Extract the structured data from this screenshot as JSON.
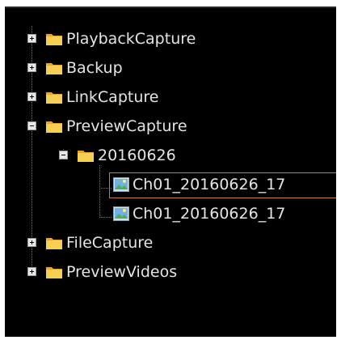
{
  "tree": {
    "items": [
      {
        "label": "PlaybackCapture",
        "icon": "folder-icon",
        "expander": "plus",
        "expanded": false
      },
      {
        "label": "Backup",
        "icon": "folder-icon",
        "expander": "plus",
        "expanded": false
      },
      {
        "label": "LinkCapture",
        "icon": "folder-icon",
        "expander": "plus",
        "expanded": false
      },
      {
        "label": "PreviewCapture",
        "icon": "folder-icon",
        "expander": "minus",
        "expanded": true,
        "children": [
          {
            "label": "20160626",
            "icon": "folder-icon",
            "expander": "minus",
            "expanded": true,
            "children": [
              {
                "label": "Ch01_20160626_17",
                "icon": "image-icon",
                "selected": true
              },
              {
                "label": "Ch01_20160626_17",
                "icon": "image-icon",
                "selected": false
              }
            ]
          }
        ]
      },
      {
        "label": "FileCapture",
        "icon": "folder-icon",
        "expander": "plus",
        "expanded": false
      },
      {
        "label": "PreviewVideos",
        "icon": "folder-icon",
        "expander": "plus",
        "expanded": false
      }
    ]
  },
  "colors": {
    "panel_background": "#000000",
    "text": "#e4e4e4",
    "selection_border": "#c0812d",
    "folder_yellow": "#f2c94c"
  }
}
